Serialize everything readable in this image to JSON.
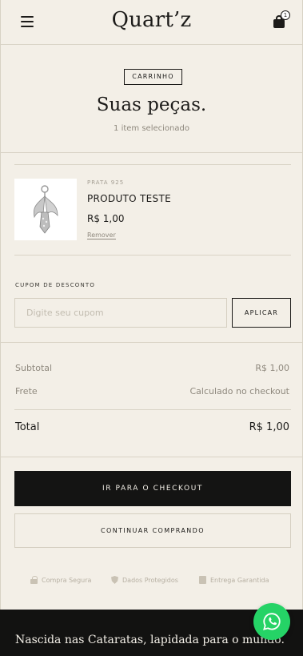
{
  "header": {
    "logo": "Quart’z",
    "cart_count": "1",
    "menu_icon": "hamburger-menu-icon",
    "cart_icon": "shopping-bag-icon"
  },
  "cart": {
    "badge": "CARRINHO",
    "title": "Suas peças.",
    "subtitle": "1 item selecionado",
    "items": [
      {
        "category": "PRATA 925",
        "name": "PRODUTO TESTE",
        "price": "R$ 1,00",
        "remove_label": "Remover"
      }
    ]
  },
  "coupon": {
    "label": "CUPOM DE DESCONTO",
    "placeholder": "Digite seu cupom",
    "apply_label": "APLICAR"
  },
  "summary": {
    "subtotal_label": "Subtotal",
    "subtotal_value": "R$ 1,00",
    "shipping_label": "Frete",
    "shipping_value": "Calculado no checkout",
    "total_label": "Total",
    "total_value": "R$ 1,00"
  },
  "actions": {
    "checkout_label": "IR PARA O CHECKOUT",
    "continue_label": "CONTINUAR COMPRANDO"
  },
  "trust": {
    "secure": "Compra Segura",
    "protected": "Dados Protegidos",
    "delivery": "Entrega Garantida"
  },
  "footer": {
    "tagline": "Nascida nas Cataratas, lapidada para o mundo."
  },
  "colors": {
    "background": "#f3efe7",
    "dark": "#141413",
    "muted": "#8f897e",
    "whatsapp": "#25d366"
  }
}
